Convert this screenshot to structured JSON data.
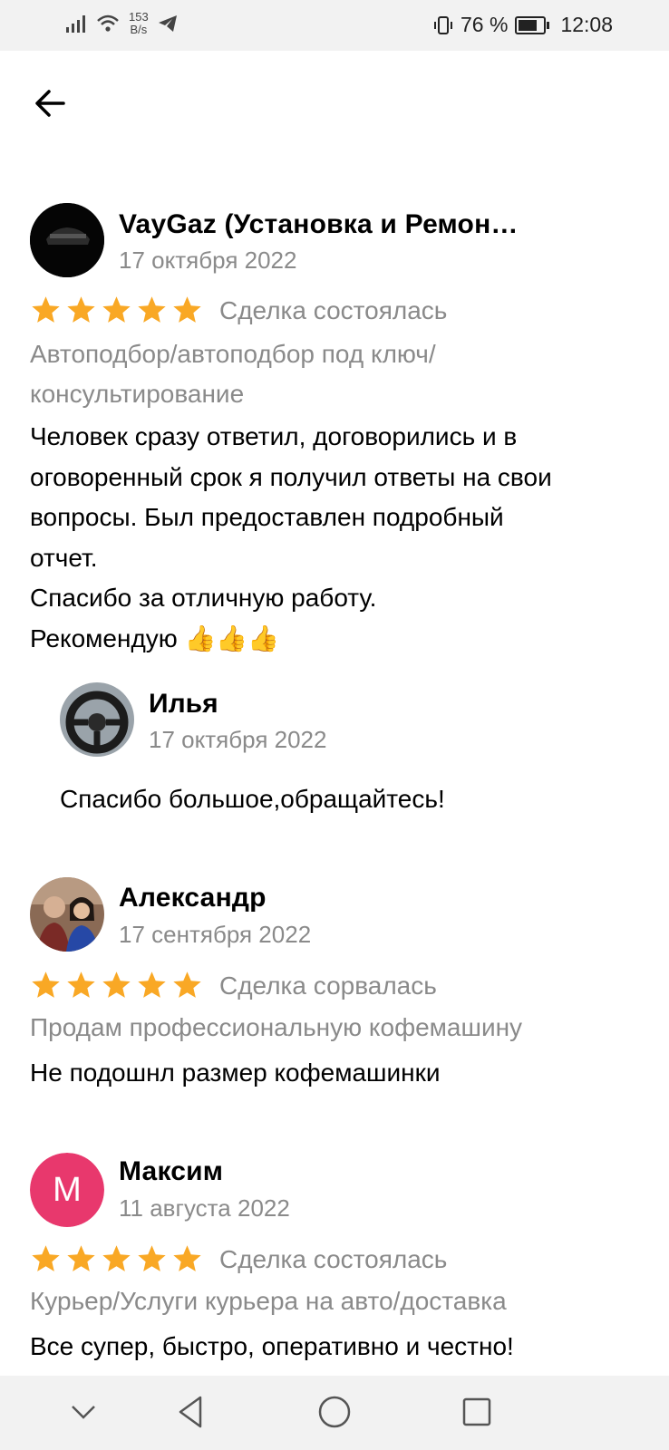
{
  "status_bar": {
    "speed_value": "153",
    "speed_unit": "B/s",
    "battery": "76 %",
    "battery_level": 0.76,
    "time": "12:08"
  },
  "reviews": [
    {
      "author": "VayGaz (Установка и Ремон…",
      "date": "17 октября 2022",
      "stars": 5,
      "deal_status": "Сделка состоялась",
      "category": "Автоподбор/автоподбор под ключ/ консультирование",
      "text_lines": [
        "Человек сразу ответил, договорились и в",
        "оговоренный срок я получил ответы на свои",
        "вопросы. Был предоставлен подробный",
        "отчет.",
        "Спасибо за отличную работу.",
        "Рекомендую 👍👍👍"
      ],
      "reply": {
        "author": "Илья",
        "date": "17 октября 2022",
        "text": "Спасибо большое,обращайтесь!"
      }
    },
    {
      "author": "Александр",
      "date": "17 сентября 2022",
      "stars": 5,
      "deal_status": "Сделка сорвалась",
      "category": "Продам профессиональную кофемашину",
      "text": "Не подошнл размер кофемашинки"
    },
    {
      "author": "Максим",
      "avatar_letter": "М",
      "avatar_color": "#e8386d",
      "date": "11 августа 2022",
      "stars": 5,
      "deal_status": "Сделка состоялась",
      "category": "Курьер/Услуги курьера на авто/доставка",
      "text": "Все супер, быстро, оперативно и честно!"
    }
  ],
  "colors": {
    "star": "#f9a825",
    "muted_text": "#8a8a8a"
  },
  "icons": {
    "back": "arrow-left-icon",
    "nav": [
      "chevron-down-icon",
      "back-triangle-icon",
      "home-circle-icon",
      "recents-square-icon"
    ]
  }
}
